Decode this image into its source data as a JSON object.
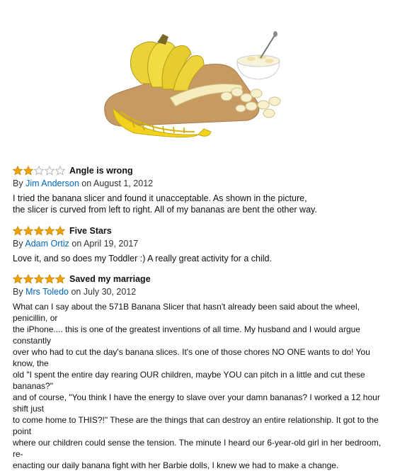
{
  "product_image": {
    "icon": "banana-slicer-product-image"
  },
  "reviews": [
    {
      "rating": 2,
      "max_rating": 5,
      "title": "Angle is wrong",
      "by": "By",
      "author": "Jim Anderson",
      "on": "on",
      "date": "August 1, 2012",
      "body_lines": [
        "I tried the banana slicer and found it unacceptable. As shown in the picture,",
        "the slicer is curved from left to right. All of my bananas are bent the other way."
      ]
    },
    {
      "rating": 5,
      "max_rating": 5,
      "title": "Five Stars",
      "by": "By",
      "author": "Adam Ortiz",
      "on": "on",
      "date": "April 19, 2017",
      "body_lines": [
        "Love it, and so does my Toddler :) A really great activity for a child."
      ]
    },
    {
      "rating": 5,
      "max_rating": 5,
      "title": "Saved my marriage",
      "by": "By",
      "author": "Mrs Toledo",
      "on": "on",
      "date": "July 30, 2012",
      "body_lines": [
        "What can I say about the 571B Banana Slicer that hasn't already been said about the wheel, penicillin, or",
        "the iPhone.... this is one of the greatest inventions of all time. My husband and I would argue constantly",
        "over who had to cut the day's banana slices. It's one of those chores NO ONE wants to do! You know, the",
        "old \"I spent the entire day rearing OUR children, maybe YOU can pitch in a little and cut these bananas?\"",
        "and of course, \"You think I have the energy to slave over your damn bananas? I worked a 12 hour shift just",
        "to come home to THIS?!\" These are the things that can destroy an entire relationship. It got to the point",
        "where our children could sense the tension. The minute I heard our 6-year-old girl in her bedroom, re-",
        "enacting our daily banana fight with her Barbie dolls, I knew we had to make a change."
      ]
    }
  ],
  "colors": {
    "star_fill": "#f0a30a",
    "star_stroke": "#c88a00",
    "link": "#0066c0"
  }
}
